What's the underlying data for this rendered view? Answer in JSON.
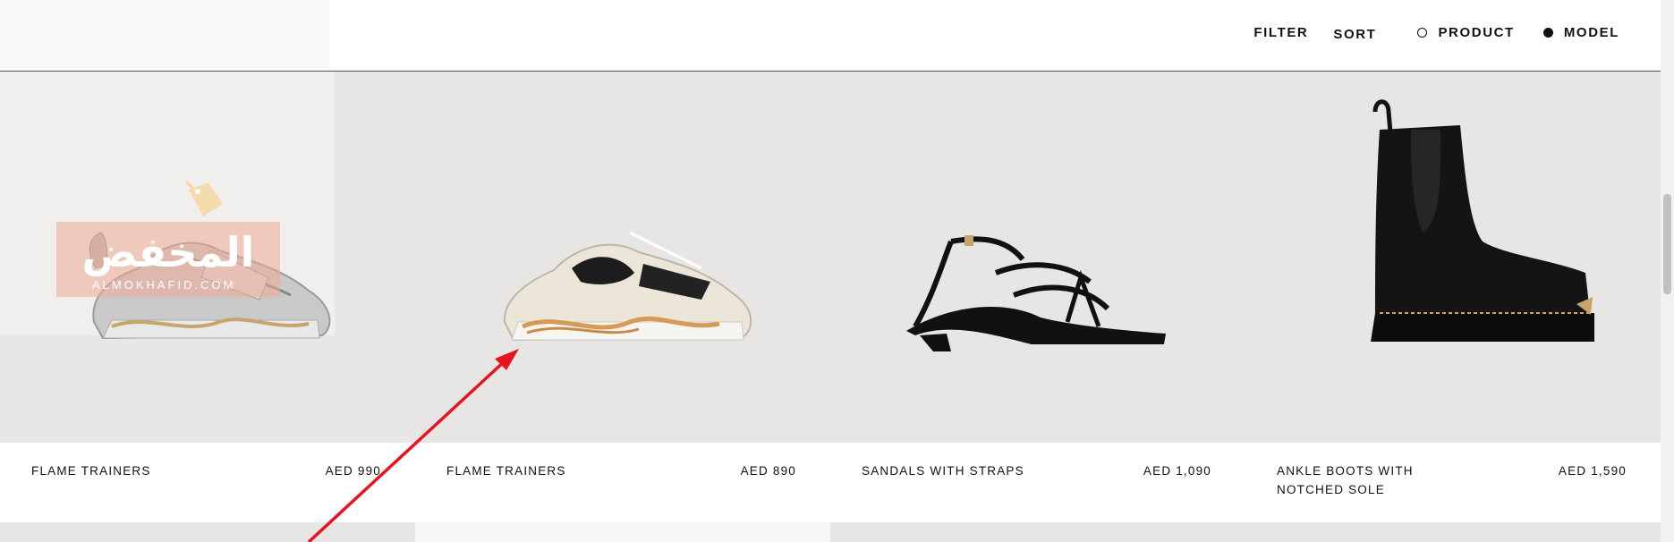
{
  "toolbar": {
    "filter_label": "FILTER",
    "sort_label": "SORT",
    "view_options": [
      {
        "label": "PRODUCT",
        "selected": false
      },
      {
        "label": "MODEL",
        "selected": true
      }
    ]
  },
  "products": [
    {
      "name": "FLAME TRAINERS",
      "price": "AED 990"
    },
    {
      "name": "FLAME TRAINERS",
      "price": "AED 890"
    },
    {
      "name": "SANDALS WITH STRAPS",
      "price": "AED 1,090"
    },
    {
      "name": "ANKLE BOOTS WITH NOTCHED SOLE",
      "price": "AED 1,590"
    }
  ],
  "watermark": {
    "arabic_text": "المخفض",
    "latin_text": "ALMOKHAFID.COM"
  },
  "colors": {
    "image_bg": "#e8e6e5",
    "annotation_arrow": "#e8141b",
    "watermark_bg": "#f0aa96"
  },
  "icons": {
    "product_radio": "radio-empty-icon",
    "model_radio": "radio-filled-icon",
    "watermark_tag": "price-tag-icon"
  }
}
